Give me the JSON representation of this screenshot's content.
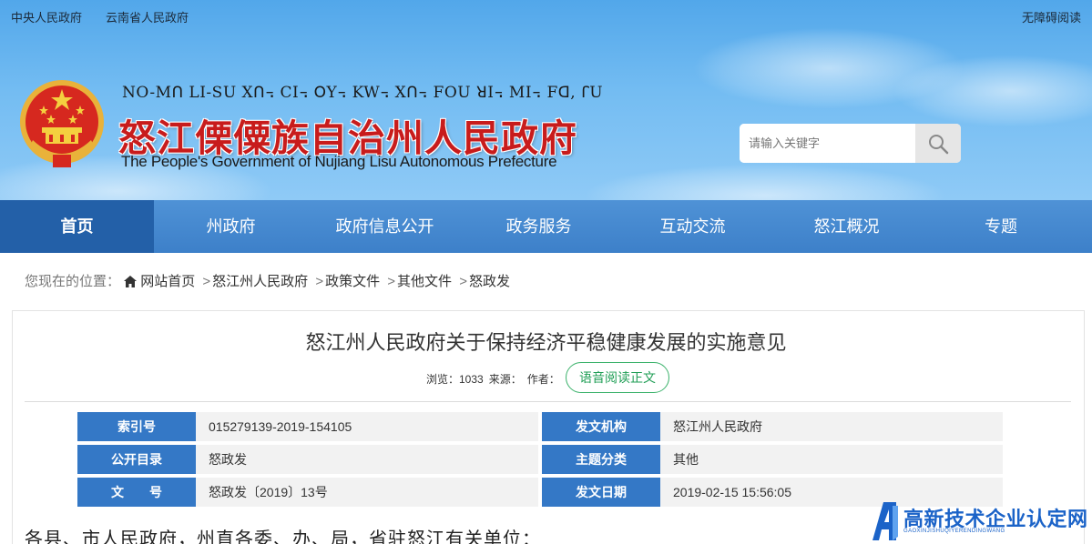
{
  "topbar": {
    "link1": "中央人民政府",
    "link2": "云南省人民政府",
    "accessibility": "无障碍阅读"
  },
  "header": {
    "lisu_title": "NO-Mꓵ LI-SU Xꓵ꓾ CI꓾ ꓳY꓾ KW꓾ Xꓵ꓾ FOU ꓤI꓾ MI꓾ Fꓷ, ꓩU",
    "title": "怒江傈僳族自治州人民政府",
    "subtitle": "The People's Government of Nujiang Lisu Autonomous Prefecture",
    "emblem_icon": "national-emblem-icon",
    "title_color": "#c81c1c"
  },
  "search": {
    "placeholder": "请输入关键字",
    "button_icon": "search-icon"
  },
  "nav": {
    "items": [
      {
        "label": "首页",
        "active": true
      },
      {
        "label": "州政府"
      },
      {
        "label": "政府信息公开"
      },
      {
        "label": "政务服务"
      },
      {
        "label": "互动交流"
      },
      {
        "label": "怒江概况"
      },
      {
        "label": "专题"
      }
    ],
    "active_color": "#2360a8"
  },
  "breadcrumb": {
    "prefix": "您现在的位置：",
    "items": [
      "网站首页",
      "怒江州人民政府",
      "政策文件",
      "其他文件",
      "怒政发"
    ],
    "separator": ">"
  },
  "article": {
    "title": "怒江州人民政府关于保持经济平稳健康发展的实施意见",
    "views": "浏览：1033",
    "source": "来源：",
    "author": "作者：",
    "tts_label": "语音阅读正文",
    "info": [
      {
        "label": "索引号",
        "value": "015279139-2019-154105"
      },
      {
        "label": "发文机构",
        "value": "怒江州人民政府"
      },
      {
        "label": "公开目录",
        "value": "怒政发"
      },
      {
        "label": "主题分类",
        "value": "其他"
      },
      {
        "label": "文　　号",
        "value": "怒政发〔2019〕13号"
      },
      {
        "label": "发文日期",
        "value": "2019-02-15 15:56:05"
      }
    ],
    "body_first_line": "各县、市人民政府，州直各委、办、局，省驻怒江有关单位：",
    "label_color": "#3478c6"
  },
  "watermark": {
    "text": "高新技术企业认定网",
    "sub": "GAOXINJISHUQIYERENDINGWANG",
    "color": "#1b63c8"
  }
}
